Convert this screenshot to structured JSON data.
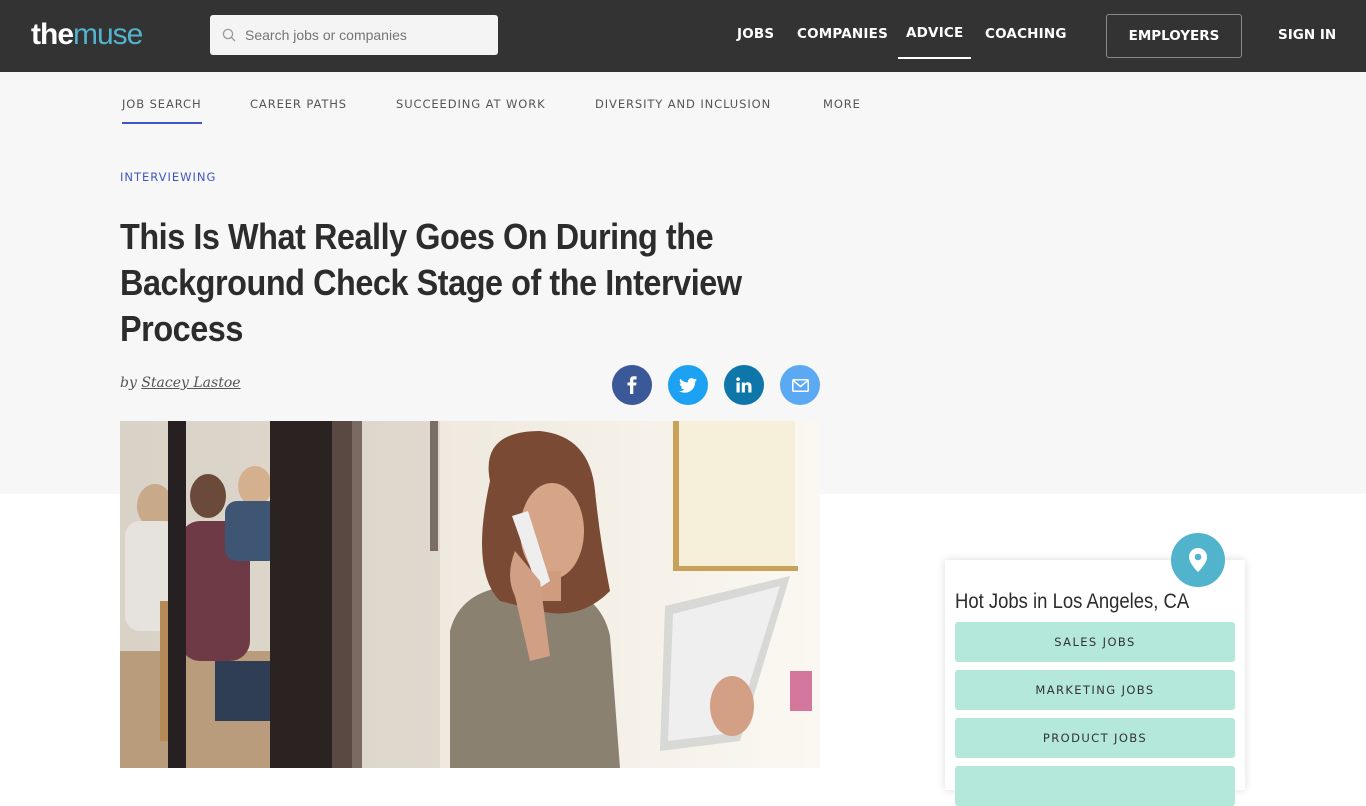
{
  "header": {
    "logo": {
      "part1": "the",
      "part2": "muse"
    },
    "search": {
      "placeholder": "Search jobs or companies",
      "value": ""
    },
    "nav": [
      {
        "label": "JOBS",
        "active": false
      },
      {
        "label": "COMPANIES",
        "active": false
      },
      {
        "label": "ADVICE",
        "active": true
      },
      {
        "label": "COACHING",
        "active": false
      }
    ],
    "employers_label": "EMPLOYERS",
    "signin_label": "SIGN IN"
  },
  "subnav": [
    {
      "label": "JOB SEARCH",
      "active": true
    },
    {
      "label": "CAREER PATHS",
      "active": false
    },
    {
      "label": "SUCCEEDING AT WORK",
      "active": false
    },
    {
      "label": "DIVERSITY AND INCLUSION",
      "active": false
    },
    {
      "label": "MORE",
      "active": false
    }
  ],
  "article": {
    "category": "INTERVIEWING",
    "title_lines": [
      "This Is What Really Goes On During the",
      "Background Check Stage of the Interview",
      "Process"
    ],
    "byline_prefix": "by",
    "author": "Stacey Lastoe",
    "share": [
      {
        "network": "facebook",
        "glyph": "f"
      },
      {
        "network": "twitter",
        "glyph": "t"
      },
      {
        "network": "linkedin",
        "glyph": "in"
      },
      {
        "network": "email",
        "glyph": "envelope"
      }
    ],
    "image_alt": "Woman on the phone holding a tablet in an office"
  },
  "sidebar": {
    "hot_jobs_title": "Hot Jobs in Los Angeles, CA",
    "jobs": [
      {
        "label": "SALES JOBS"
      },
      {
        "label": "MARKETING JOBS"
      },
      {
        "label": "PRODUCT JOBS"
      },
      {
        "label": ""
      }
    ]
  },
  "colors": {
    "header_bg": "#333333",
    "brand_teal": "#52b3cc",
    "accent_blue": "#3e57c4",
    "hero_bg": "#f7f7f7",
    "job_button": "#b3e8da",
    "facebook": "#3b5998",
    "twitter": "#1da1f2",
    "linkedin": "#0e76a8",
    "email": "#5aa9f2"
  }
}
